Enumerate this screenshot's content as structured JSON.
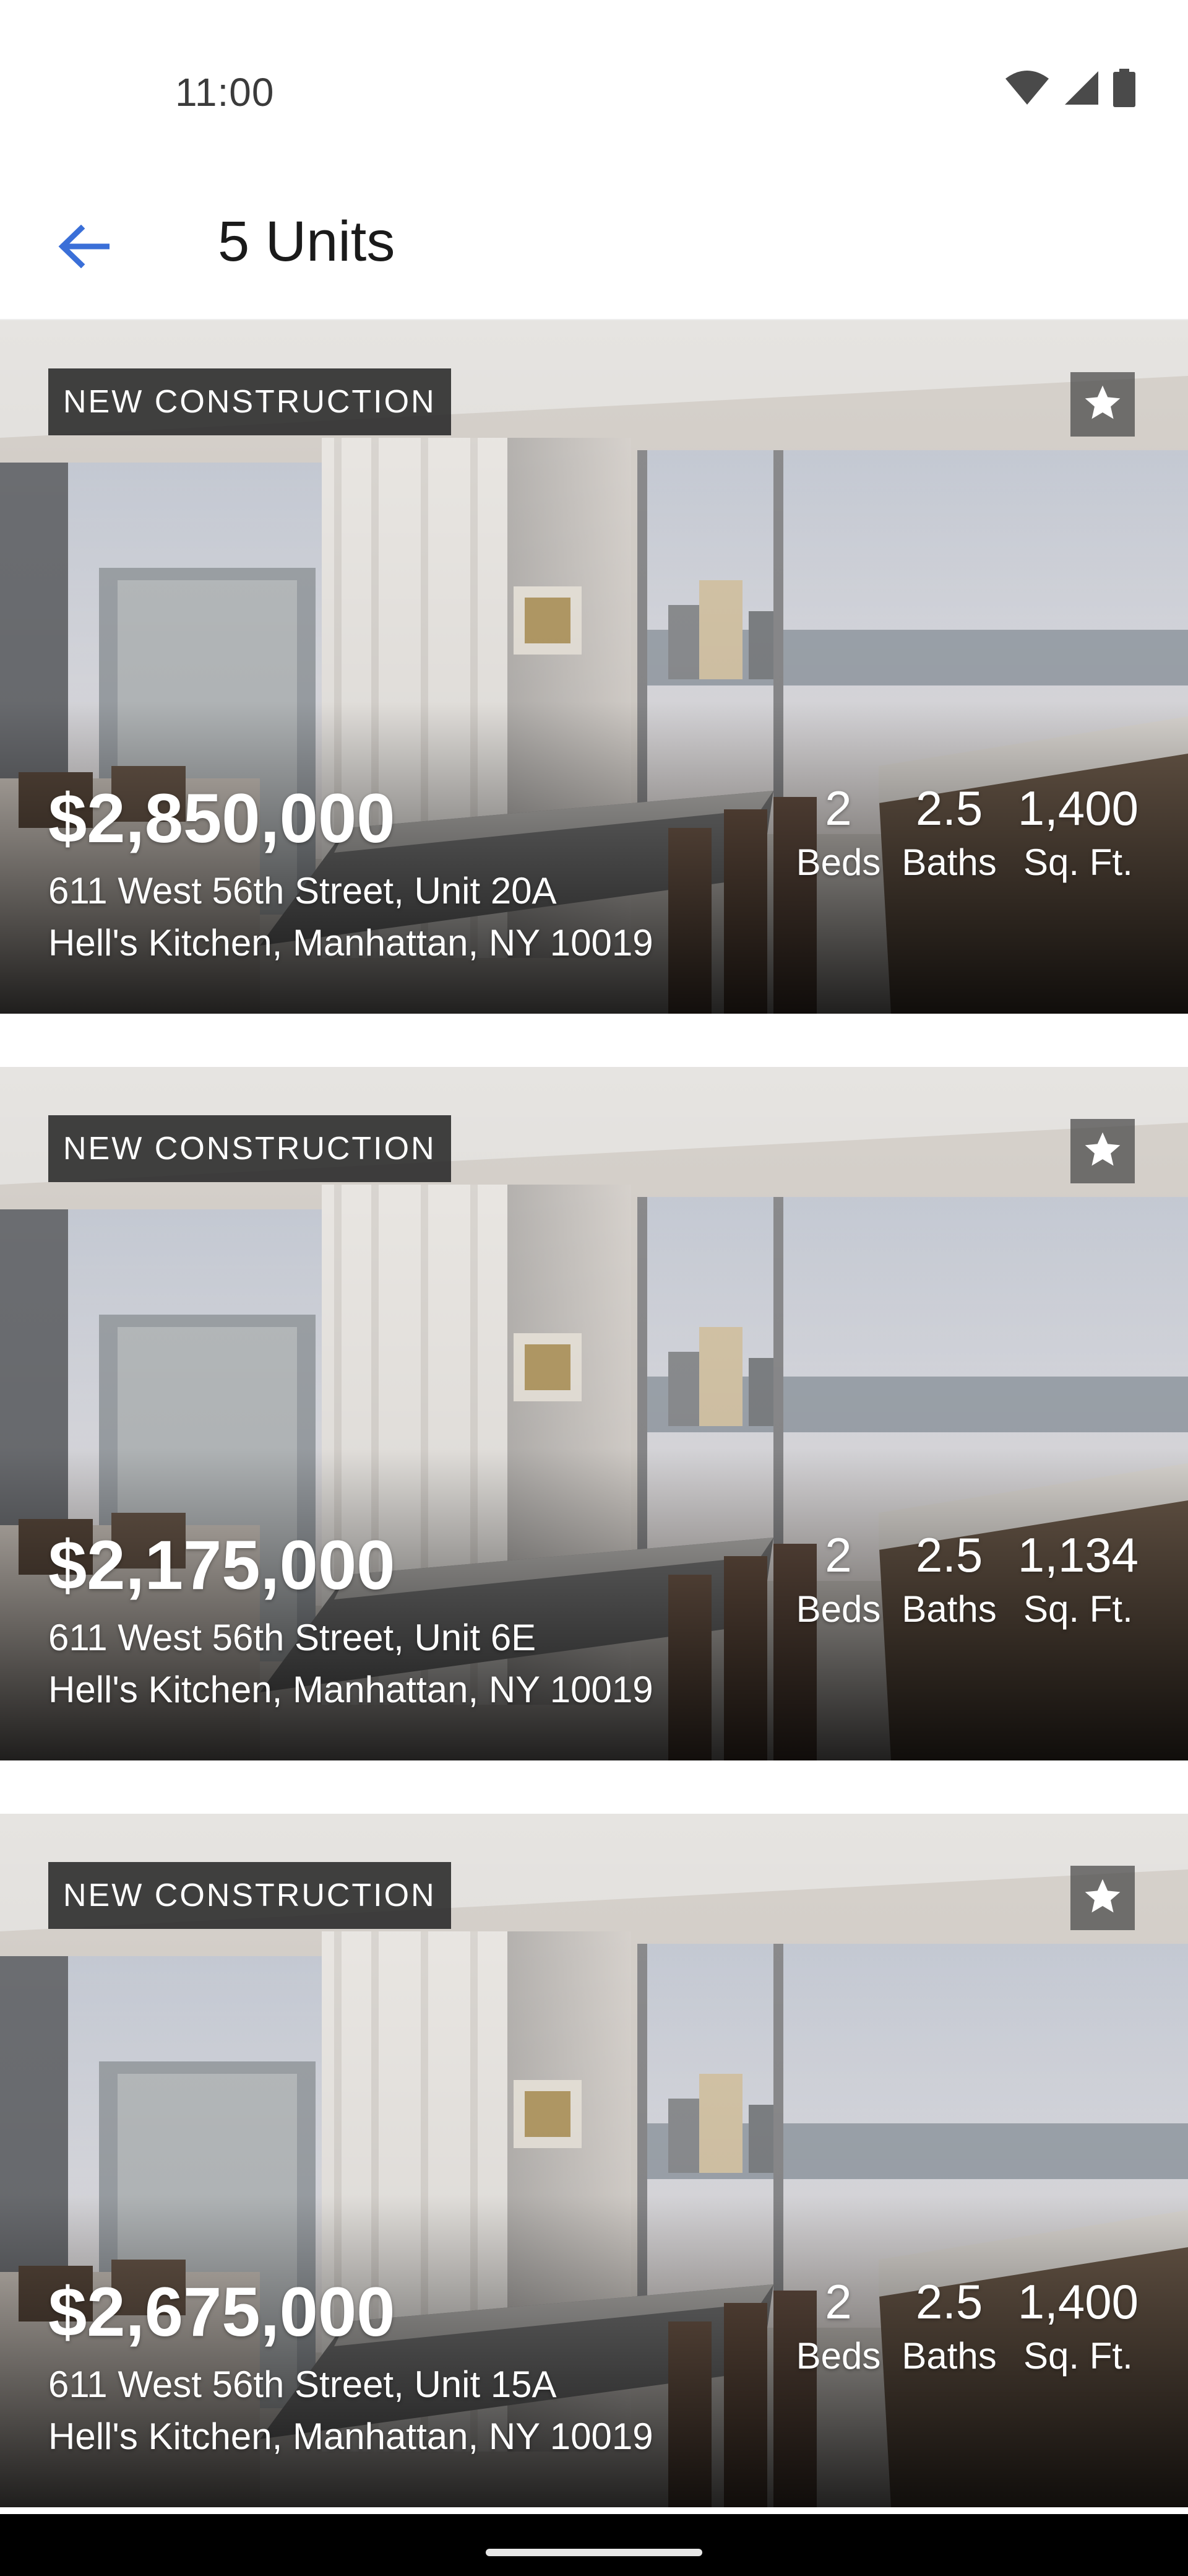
{
  "status_bar": {
    "time": "11:00",
    "icons": [
      "wifi-icon",
      "signal-icon",
      "battery-icon"
    ]
  },
  "header": {
    "title": "5 Units",
    "back_icon": "arrow-left-icon",
    "accent_color": "#3a6fd8"
  },
  "listings": [
    {
      "badge": "NEW CONSTRUCTION",
      "price": "$2,850,000",
      "address_line1": "611 West 56th Street, Unit 20A",
      "address_line2": "Hell's Kitchen, Manhattan, NY 10019",
      "beds_value": "2",
      "beds_label": "Beds",
      "baths_value": "2.5",
      "baths_label": "Baths",
      "sqft_value": "1,400",
      "sqft_label": "Sq. Ft."
    },
    {
      "badge": "NEW CONSTRUCTION",
      "price": "$2,175,000",
      "address_line1": "611 West 56th Street, Unit 6E",
      "address_line2": "Hell's Kitchen, Manhattan, NY 10019",
      "beds_value": "2",
      "beds_label": "Beds",
      "baths_value": "2.5",
      "baths_label": "Baths",
      "sqft_value": "1,134",
      "sqft_label": "Sq. Ft."
    },
    {
      "badge": "NEW CONSTRUCTION",
      "price": "$2,675,000",
      "address_line1": "611 West 56th Street, Unit 15A",
      "address_line2": "Hell's Kitchen, Manhattan, NY 10019",
      "beds_value": "2",
      "beds_label": "Beds",
      "baths_value": "2.5",
      "baths_label": "Baths",
      "sqft_value": "1,400",
      "sqft_label": "Sq. Ft."
    }
  ]
}
